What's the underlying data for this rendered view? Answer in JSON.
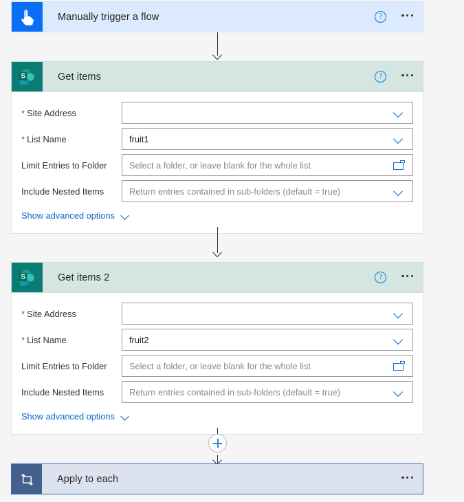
{
  "flow": {
    "steps": [
      {
        "id": "trigger",
        "title": "Manually trigger a flow",
        "icon": "tap-hand-icon",
        "help_label": "?",
        "more_label": "More commands"
      },
      {
        "id": "get-items-1",
        "title": "Get items",
        "icon": "sharepoint-icon",
        "help_label": "?",
        "more_label": "More commands",
        "fields": [
          {
            "label": "Site Address",
            "required": true,
            "value": "",
            "placeholder": "",
            "control": "dropdown"
          },
          {
            "label": "List Name",
            "required": true,
            "value": "fruit1",
            "placeholder": "",
            "control": "dropdown"
          },
          {
            "label": "Limit Entries to Folder",
            "required": false,
            "value": "",
            "placeholder": "Select a folder, or leave blank for the whole list",
            "control": "folder"
          },
          {
            "label": "Include Nested Items",
            "required": false,
            "value": "",
            "placeholder": "Return entries contained in sub-folders (default = true)",
            "control": "dropdown"
          }
        ],
        "advanced_label": "Show advanced options"
      },
      {
        "id": "get-items-2",
        "title": "Get items 2",
        "icon": "sharepoint-icon",
        "help_label": "?",
        "more_label": "More commands",
        "fields": [
          {
            "label": "Site Address",
            "required": true,
            "value": "",
            "placeholder": "",
            "control": "dropdown"
          },
          {
            "label": "List Name",
            "required": true,
            "value": "fruit2",
            "placeholder": "",
            "control": "dropdown"
          },
          {
            "label": "Limit Entries to Folder",
            "required": false,
            "value": "",
            "placeholder": "Select a folder, or leave blank for the whole list",
            "control": "folder"
          },
          {
            "label": "Include Nested Items",
            "required": false,
            "value": "",
            "placeholder": "Return entries contained in sub-folders (default = true)",
            "control": "dropdown"
          }
        ],
        "advanced_label": "Show advanced options"
      },
      {
        "id": "apply-to-each",
        "title": "Apply to each",
        "icon": "loop-icon",
        "more_label": "More commands",
        "selected": true
      }
    ],
    "add_step_label": "Insert a new step"
  },
  "colors": {
    "trigger_header": "#dbeafe",
    "trigger_icon": "#0b6ef5",
    "sharepoint_header": "#d5e6e2",
    "sharepoint_icon": "#0b7c74",
    "loop_border": "#2b6cb0",
    "loop_body": "#dde3ee",
    "loop_icon": "#44618e",
    "link": "#0b66d0",
    "required": "#c0392b",
    "canvas": "#f5f5f5"
  }
}
